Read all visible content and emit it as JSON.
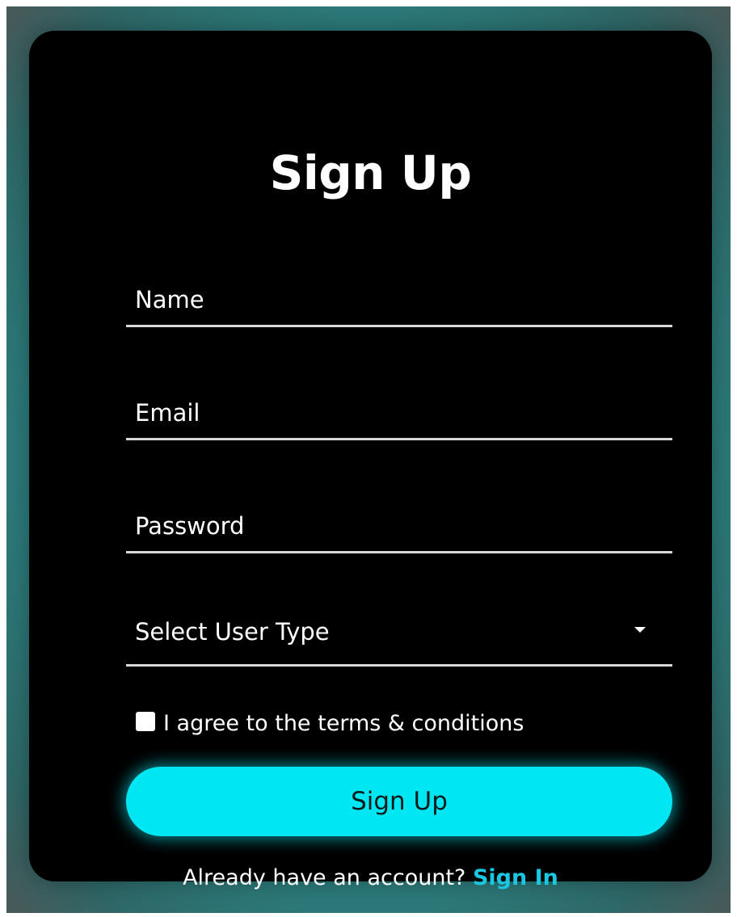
{
  "form": {
    "title": "Sign Up",
    "name_placeholder": "Name",
    "email_placeholder": "Email",
    "password_placeholder": "Password",
    "user_type_label": "Select User Type",
    "terms_label": "I agree to the terms & conditions",
    "submit_label": "Sign Up",
    "footer_text": "Already have an account?",
    "footer_link": "Sign In"
  },
  "colors": {
    "accent": "#00e6f2",
    "link": "#19c7e0",
    "card": "#000000",
    "background": "#2a8a8a"
  },
  "icons": {
    "dropdown": "caret-down-icon",
    "checkbox": "checkbox-unchecked"
  }
}
